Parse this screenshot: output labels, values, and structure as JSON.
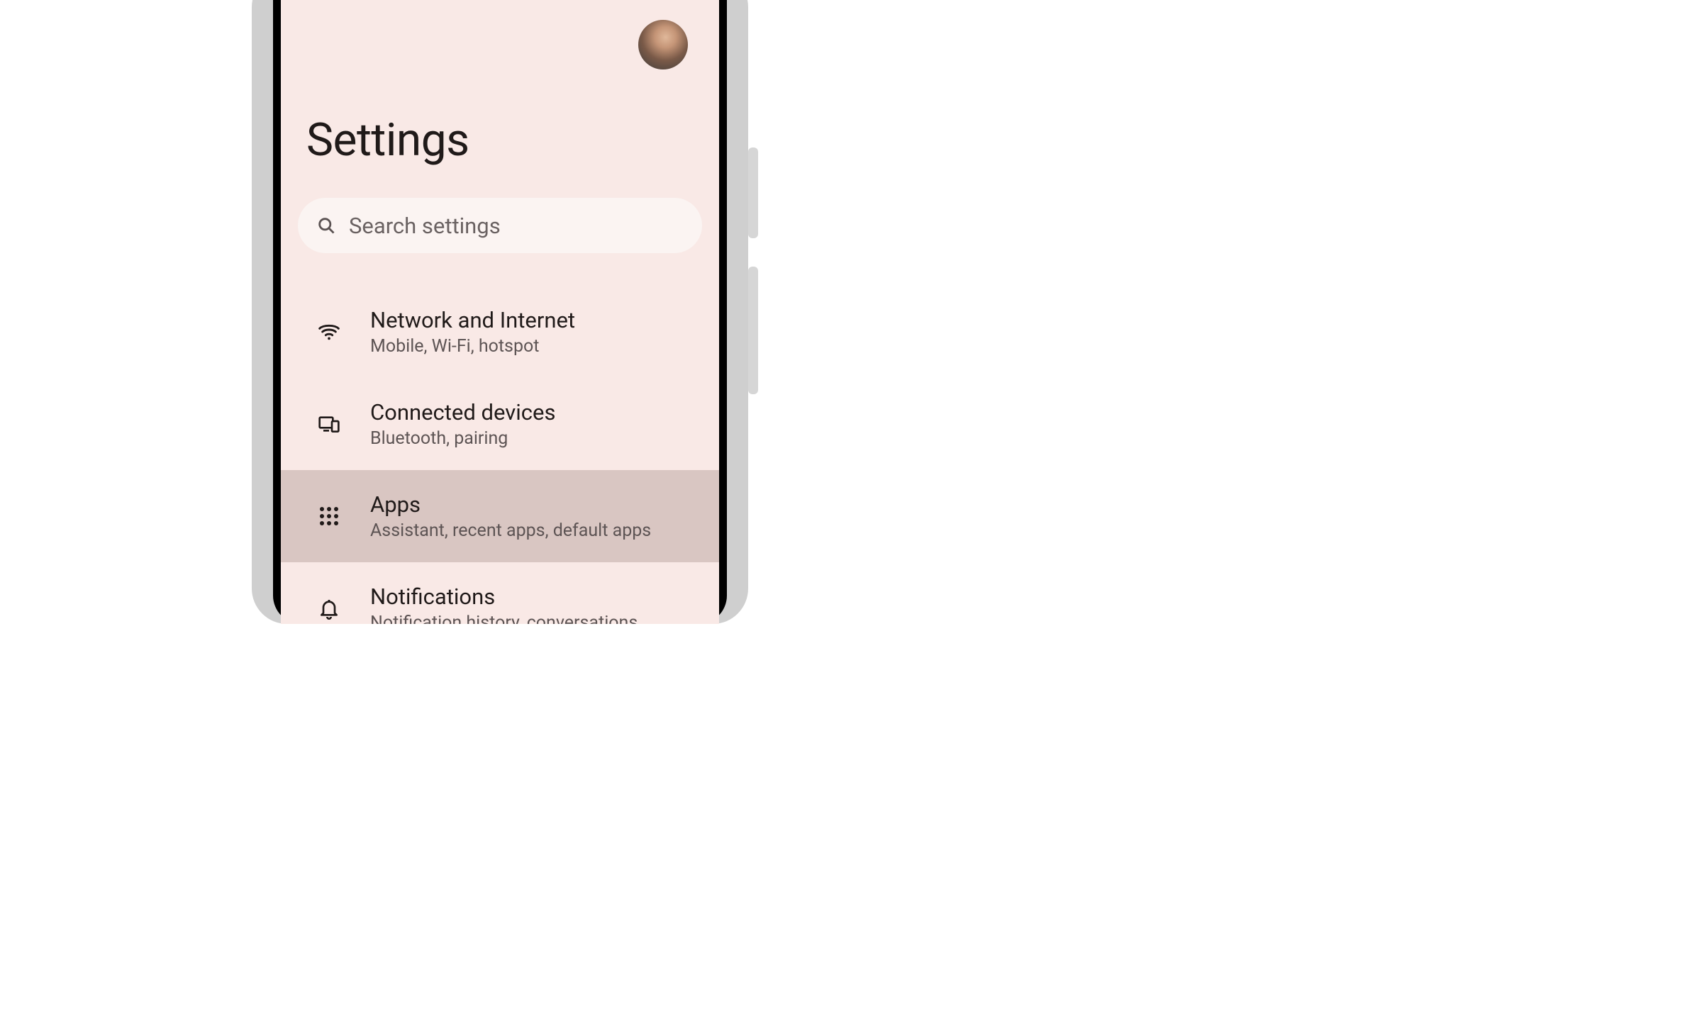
{
  "header": {
    "title": "Settings"
  },
  "search": {
    "placeholder": "Search settings"
  },
  "items": [
    {
      "title": "Network and Internet",
      "subtitle": "Mobile, Wi-Fi, hotspot"
    },
    {
      "title": "Connected devices",
      "subtitle": "Bluetooth, pairing"
    },
    {
      "title": "Apps",
      "subtitle": "Assistant, recent apps, default apps"
    },
    {
      "title": "Notifications",
      "subtitle": "Notification history, conversations"
    }
  ]
}
